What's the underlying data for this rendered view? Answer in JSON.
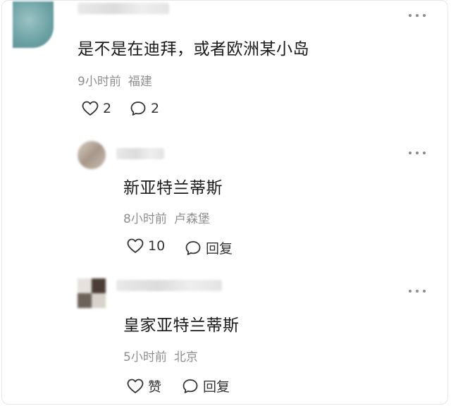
{
  "comments": [
    {
      "text": "是不是在迪拜，或者欧洲某小岛",
      "time": "9小时前",
      "location": "福建",
      "likes": "2",
      "replies": "2"
    },
    {
      "text": "新亚特兰蒂斯",
      "time": "8小时前",
      "location": "卢森堡",
      "likes": "10",
      "reply_label": "回复"
    },
    {
      "text": "皇家亚特兰蒂斯",
      "time": "5小时前",
      "location": "北京",
      "like_label": "赞",
      "reply_label": "回复"
    }
  ],
  "icons": {
    "like": "heart-icon",
    "reply": "speech-bubble-icon",
    "more": "more-dots-icon"
  },
  "colors": {
    "meta_text": "#8e8e8e",
    "body_text": "#1a1a1a",
    "icon_stroke": "#333333"
  }
}
